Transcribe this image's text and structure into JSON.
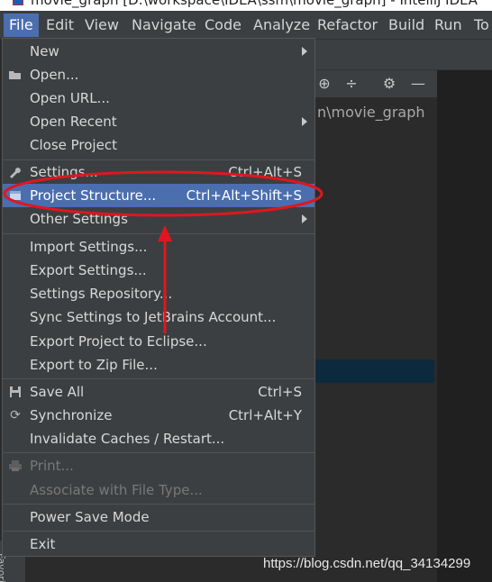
{
  "window": {
    "title": "movie_graph [D:\\workspace\\IDEA\\ssm\\movie_graph] - IntelliJ IDEA"
  },
  "menubar": {
    "items": [
      {
        "label": "File"
      },
      {
        "label": "Edit"
      },
      {
        "label": "View"
      },
      {
        "label": "Navigate"
      },
      {
        "label": "Code"
      },
      {
        "label": "Analyze"
      },
      {
        "label": "Refactor"
      },
      {
        "label": "Build"
      },
      {
        "label": "Run"
      },
      {
        "label": "To"
      }
    ]
  },
  "editor": {
    "path_fragment": "n\\movie_graph",
    "side_tab": "Favori"
  },
  "file_menu": {
    "items": [
      {
        "label": "New"
      },
      {
        "label": "Open..."
      },
      {
        "label": "Open URL..."
      },
      {
        "label": "Open Recent"
      },
      {
        "label": "Close Project"
      },
      {
        "label": "Settings...",
        "shortcut": "Ctrl+Alt+S"
      },
      {
        "label": "Project Structure...",
        "shortcut": "Ctrl+Alt+Shift+S"
      },
      {
        "label": "Other Settings"
      },
      {
        "label": "Import Settings..."
      },
      {
        "label": "Export Settings..."
      },
      {
        "label": "Settings Repository..."
      },
      {
        "label": "Sync Settings to JetBrains Account..."
      },
      {
        "label": "Export Project to Eclipse..."
      },
      {
        "label": "Export to Zip File..."
      },
      {
        "label": "Save All",
        "shortcut": "Ctrl+S"
      },
      {
        "label": "Synchronize",
        "shortcut": "Ctrl+Alt+Y"
      },
      {
        "label": "Invalidate Caches / Restart..."
      },
      {
        "label": "Print..."
      },
      {
        "label": "Associate with File Type..."
      },
      {
        "label": "Power Save Mode"
      },
      {
        "label": "Exit"
      }
    ]
  },
  "watermark": "https://blog.csdn.net/qq_34134299",
  "colors": {
    "selection": "#4b6eaf",
    "annotation": "#e0161e"
  }
}
